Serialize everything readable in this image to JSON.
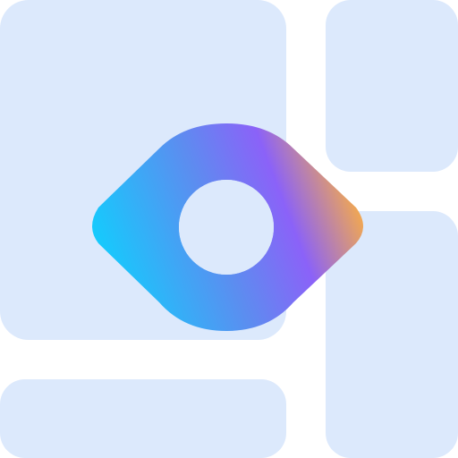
{
  "icon": {
    "name": "dashboard-eye-icon",
    "tile_color": "#dce9fc",
    "background_color": "#ffffff",
    "eye_gradient": [
      "#0fd0fe",
      "#5c8df0",
      "#8b62f8",
      "#ffb13b"
    ],
    "pupil_color": "#dce9fc"
  }
}
